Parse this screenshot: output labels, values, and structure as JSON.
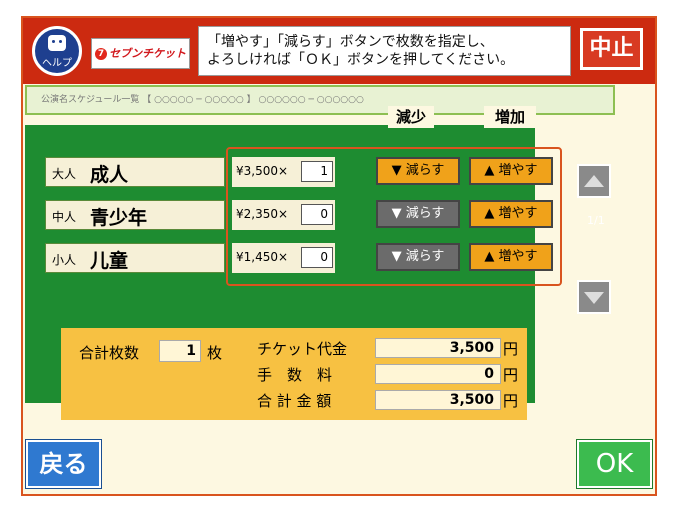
{
  "header": {
    "help_label": "ヘルプ",
    "logo_text": "セブンチケット",
    "logo_mark": "7",
    "instructions_line1": "「増やす」「減らす」ボタンで枚数を指定し、",
    "instructions_line2": "よろしければ「ＯＫ」ボタンを押してください。",
    "stop_label": "中止"
  },
  "event_title": "公演名スケジュール一覧 【 ○○○○○ ─ ○○○○○ 】 ○○○○○○ ─ ○○○○○○",
  "column_headers": {
    "decrease": "減少",
    "increase": "増加"
  },
  "tickets": [
    {
      "small": "大人",
      "big": "成人",
      "price": "¥3,500×",
      "qty": "1",
      "dec_label": "▼ 減らす",
      "inc_label": "▲ 増やす",
      "dec_enabled": true
    },
    {
      "small": "中人",
      "big": "青少年",
      "price": "¥2,350×",
      "qty": "0",
      "dec_label": "▼ 減らす",
      "inc_label": "▲ 増やす",
      "dec_enabled": false
    },
    {
      "small": "小人",
      "big": "儿童",
      "price": "¥1,450×",
      "qty": "0",
      "dec_label": "▼ 減らす",
      "inc_label": "▲ 増やす",
      "dec_enabled": false
    }
  ],
  "pagination": {
    "indicator": "1/1"
  },
  "summary": {
    "total_count_label": "合計枚数",
    "total_count": "1",
    "count_unit": "枚",
    "ticket_fee_label": "チケット代金",
    "ticket_fee": "3,500",
    "handling_label": "手　数　料",
    "handling_fee": "0",
    "total_label": "合 計 金 額",
    "total_amount": "3,500",
    "yen": "円"
  },
  "footer": {
    "back_label": "戻る",
    "ok_label": "OK"
  },
  "colors": {
    "header_red": "#cc2a10",
    "panel_green": "#1e8c31",
    "button_orange": "#f0a21a",
    "summary_yellow": "#f7c142",
    "ok_green": "#3cbb4f",
    "back_blue": "#2f79d0"
  }
}
